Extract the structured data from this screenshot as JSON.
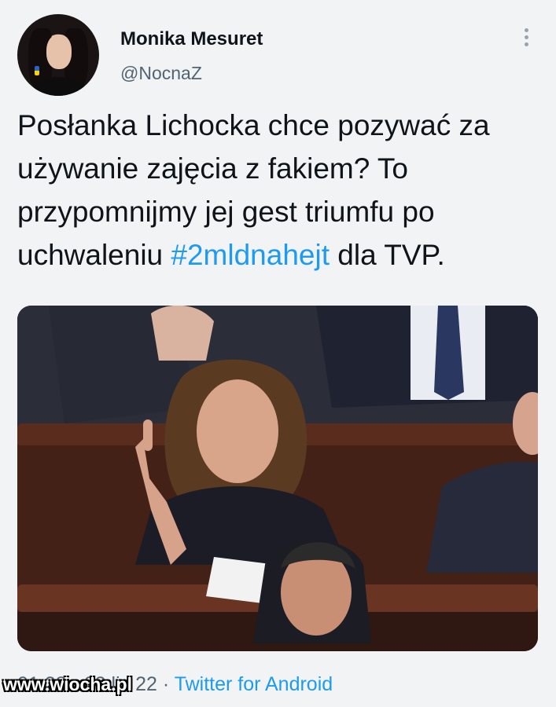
{
  "author": {
    "display_name": "Monika Mesuret",
    "handle": "@NocnaZ"
  },
  "tweet": {
    "text_before": "Posłanka Lichocka chce pozywać za używanie zajęcia z fakiem? To przypomnijmy jej gest triumfu po uchwaleniu ",
    "hashtag": "#2mldnahejt",
    "text_after": " dla TVP."
  },
  "meta": {
    "date_partial": "01:28 · 03 lis 22",
    "separator": "·",
    "source": "Twitter for Android"
  },
  "watermark": "www.wiocha.pl",
  "colors": {
    "link": "#1d9bf0",
    "secondary_text": "#536471",
    "background": "#f1f3f5"
  },
  "icons": {
    "more": "more-vertical-icon"
  }
}
